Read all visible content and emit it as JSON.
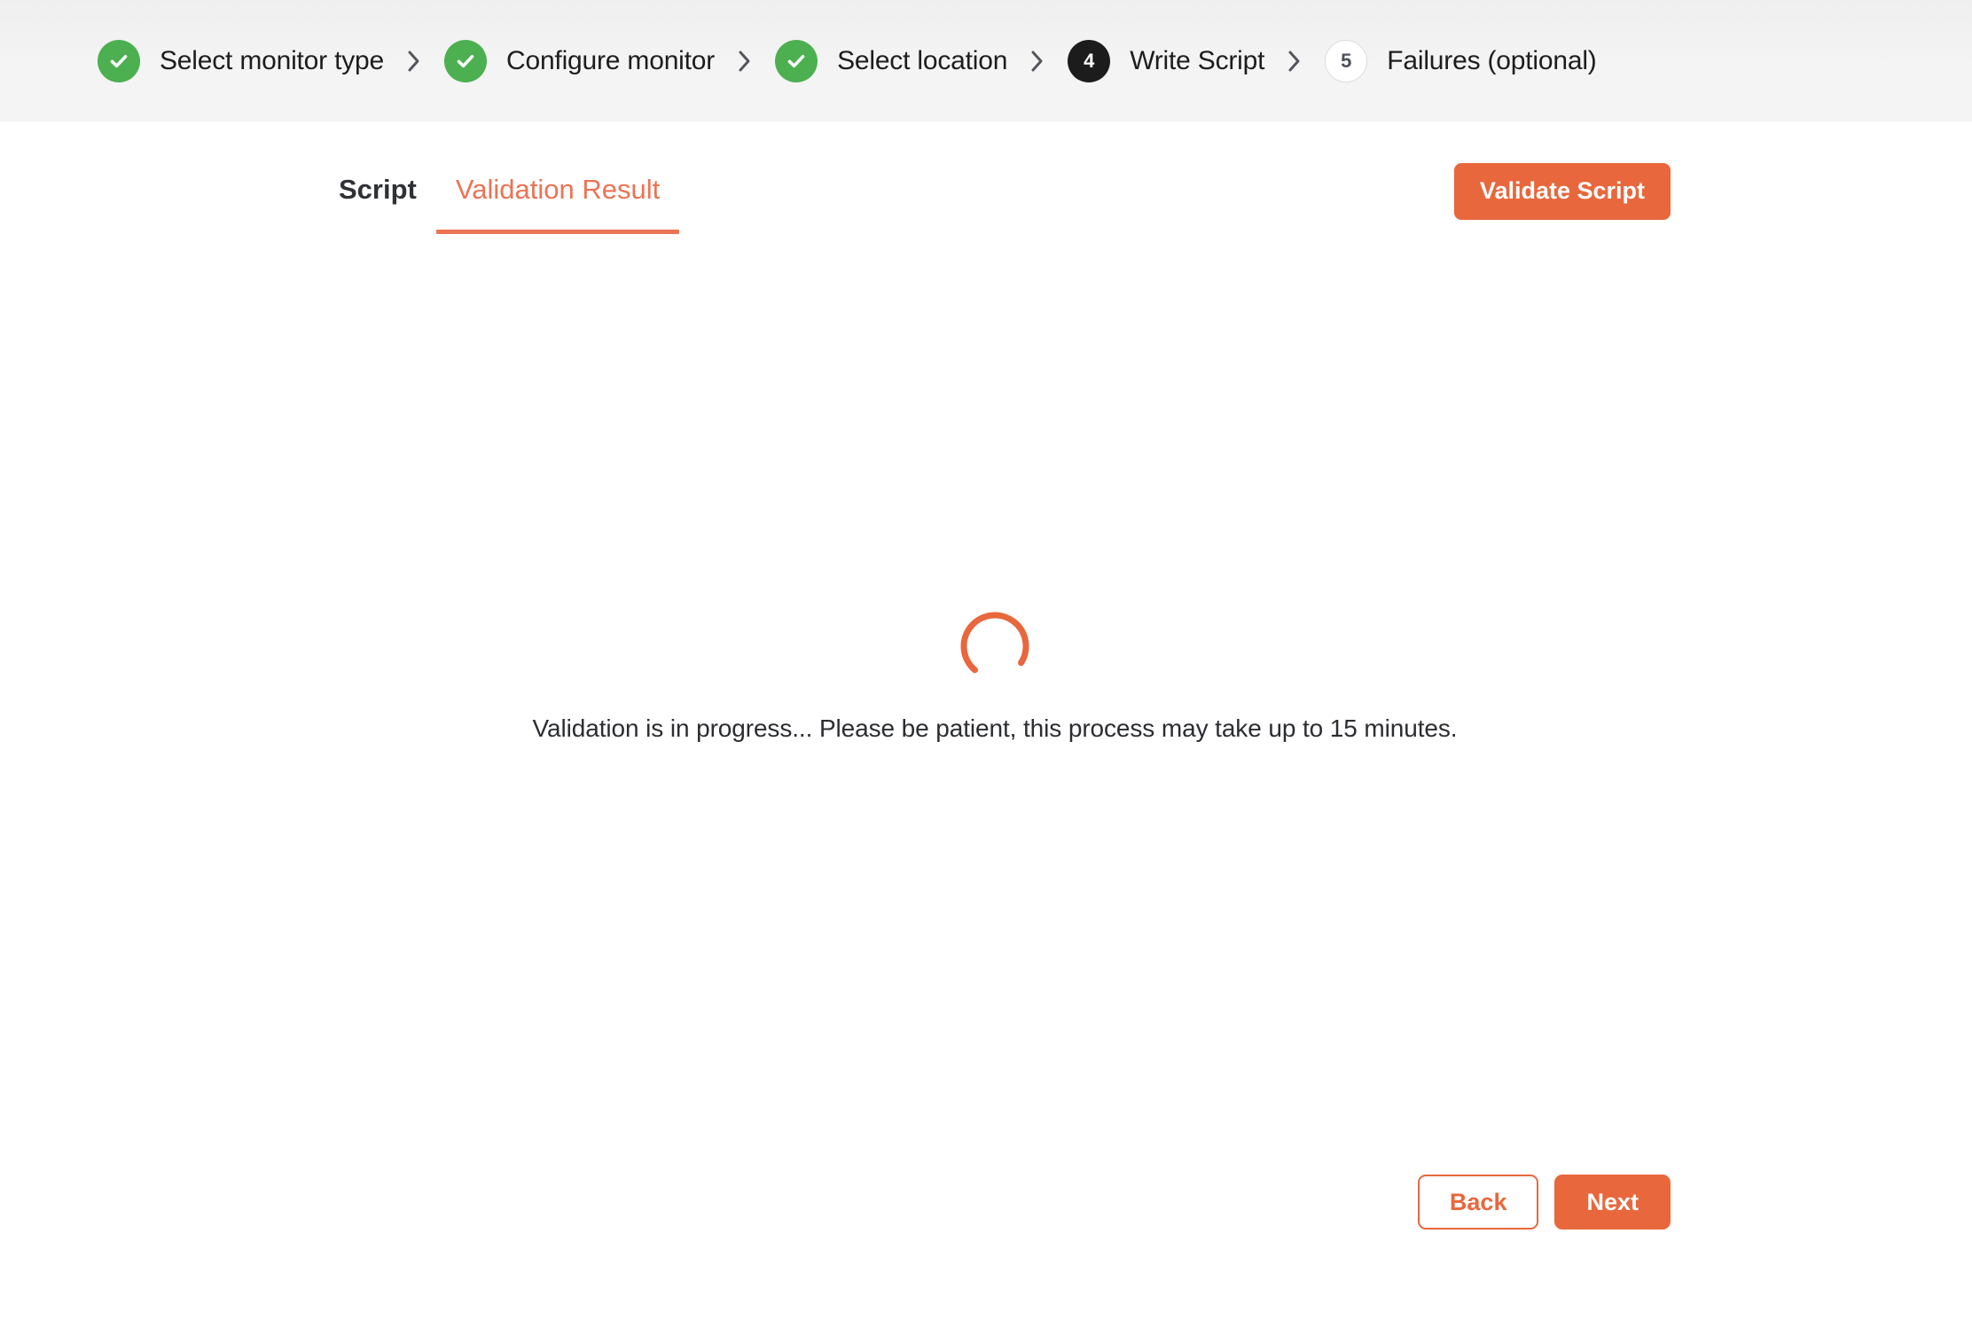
{
  "stepper": {
    "steps": [
      {
        "label": "Select monitor type",
        "state": "done",
        "marker": "check-icon"
      },
      {
        "label": "Configure monitor",
        "state": "done",
        "marker": "check-icon"
      },
      {
        "label": "Select location",
        "state": "done",
        "marker": "check-icon"
      },
      {
        "label": "Write Script",
        "state": "current",
        "marker": "4"
      },
      {
        "label": "Failures (optional)",
        "state": "pending",
        "marker": "5"
      }
    ],
    "separator": "chevron-right-icon"
  },
  "tabs": [
    {
      "label": "Script",
      "active": false
    },
    {
      "label": "Validation Result",
      "active": true
    }
  ],
  "toolbar": {
    "validate_label": "Validate Script"
  },
  "loading": {
    "spinner": "loading-spinner-icon",
    "message": "Validation is in progress... Please be patient, this process may take up to 15 minutes."
  },
  "footer": {
    "back_label": "Back",
    "next_label": "Next"
  },
  "colors": {
    "accent": "#e8673c",
    "accent_light": "#ec7353",
    "done": "#4caf50",
    "current": "#1c1c1c",
    "header_bg": "#f4f4f4",
    "pending_border": "#dcdcdc"
  }
}
